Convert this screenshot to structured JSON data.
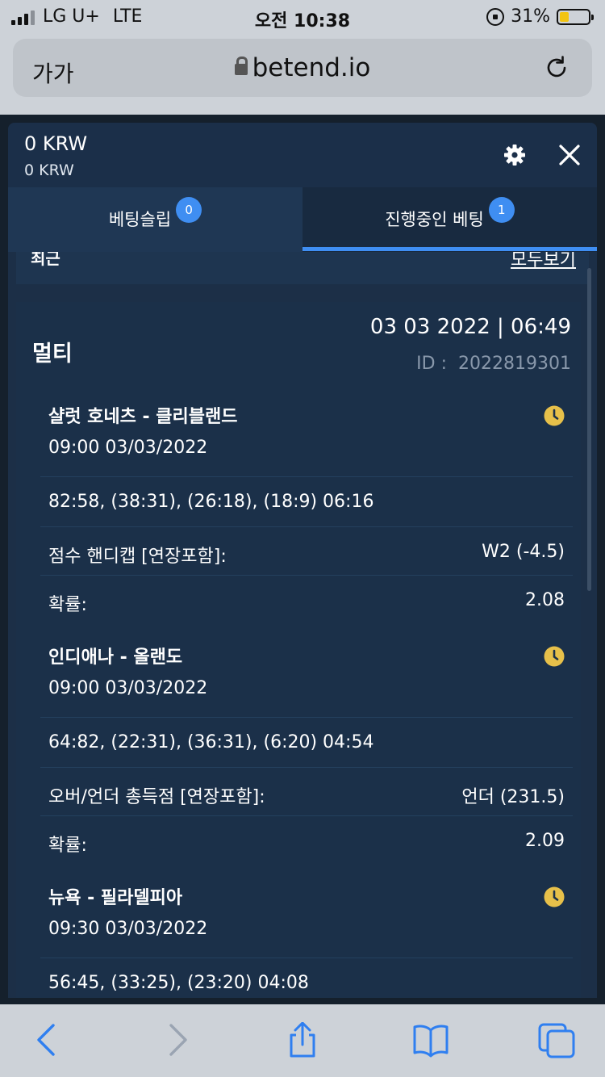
{
  "status_bar": {
    "carrier": "LG U+",
    "network": "LTE",
    "time": "오전 10:38",
    "battery": "31%",
    "battery_level": 0.31,
    "battery_color": "#f2c412"
  },
  "browser": {
    "text_size_label": "가가",
    "url": "betend.io",
    "reload_icon": "reload-icon"
  },
  "modal": {
    "balance_primary": "0 KRW",
    "balance_secondary": "0 KRW",
    "settings_icon": "gear-icon",
    "close_icon": "close-icon",
    "tabs": [
      {
        "label": "베팅슬립",
        "badge": "0",
        "active": false
      },
      {
        "label": "진행중인 베팅",
        "badge": "1",
        "active": true
      }
    ],
    "recent_label": "최근",
    "view_all_label": "모두보기",
    "accent_color": "#3f8ef2"
  },
  "bet": {
    "type_label": "멀티",
    "datetime": "03 03 2022 | 06:49",
    "id_label": "ID :",
    "id_value": "2022819301",
    "legs": [
      {
        "match": "샬럿 호네츠 - 클리블랜드",
        "date": "09:00   03/03/2022",
        "score": "82:58, (38:31), (26:18), (18:9) 06:16",
        "market_label": "점수 핸디캡 [연장포함]:",
        "market_value": "W2 (-4.5)",
        "odds_label": "확률:",
        "odds_value": "2.08"
      },
      {
        "match": "인디애나 - 올랜도",
        "date": "09:00   03/03/2022",
        "score": "64:82, (22:31), (36:31), (6:20) 04:54",
        "market_label": "오버/언더 총득점 [연장포함]:",
        "market_value": "언더 (231.5)",
        "odds_label": "확률:",
        "odds_value": "2.09"
      },
      {
        "match": "뉴욕 - 필라델피아",
        "date": "09:30   03/03/2022",
        "score": "56:45, (33:25), (23:20) 04:08"
      }
    ],
    "pending_icon_color": "#e7c04a"
  },
  "toolbar": {
    "back_icon": "back-icon",
    "forward_icon": "forward-icon",
    "share_icon": "share-icon",
    "bookmarks_icon": "bookmarks-icon",
    "tabs_icon": "tabs-icon"
  }
}
